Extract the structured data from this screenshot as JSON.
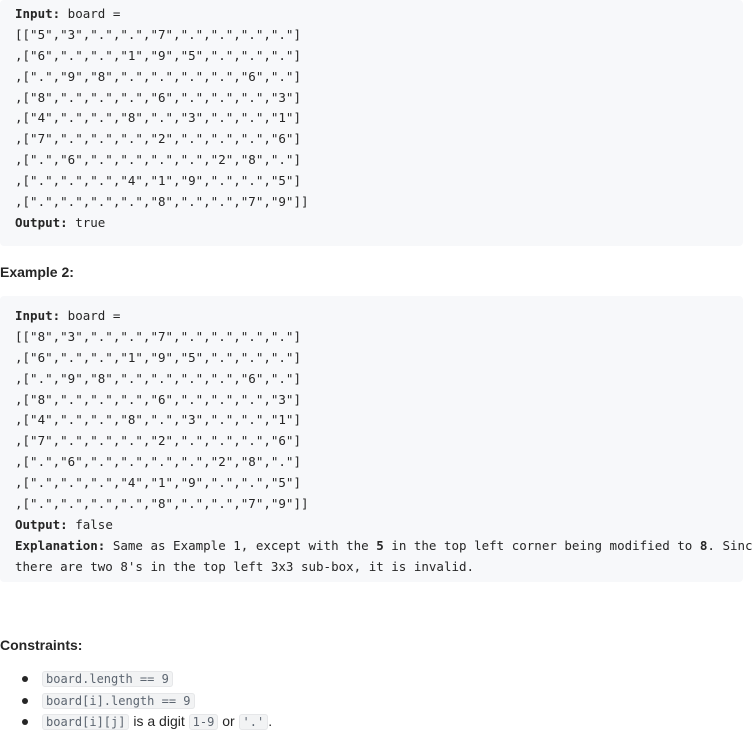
{
  "example1": {
    "input_label": "Input:",
    "input_var": " board =",
    "rows": [
      "[[\"5\",\"3\",\".\",\".\",\"7\",\".\",\".\",\".\",\".\"]",
      ",[\"6\",\".\",\".\",\"1\",\"9\",\"5\",\".\",\".\",\".\"]",
      ",[\".\",\"9\",\"8\",\".\",\".\",\".\",\".\",\"6\",\".\"]",
      ",[\"8\",\".\",\".\",\".\",\"6\",\".\",\".\",\".\",\"3\"]",
      ",[\"4\",\".\",\".\",\"8\",\".\",\"3\",\".\",\".\",\"1\"]",
      ",[\"7\",\".\",\".\",\".\",\"2\",\".\",\".\",\".\",\"6\"]",
      ",[\".\",\"6\",\".\",\".\",\".\",\".\",\"2\",\"8\",\".\"]",
      ",[\".\",\".\",\".\",\"4\",\"1\",\"9\",\".\",\".\",\"5\"]",
      ",[\".\",\".\",\".\",\".\",\"8\",\".\",\".\",\"7\",\"9\"]]"
    ],
    "output_label": "Output:",
    "output_value": " true"
  },
  "example2": {
    "heading": "Example 2:",
    "input_label": "Input:",
    "input_var": " board =",
    "rows": [
      "[[\"8\",\"3\",\".\",\".\",\"7\",\".\",\".\",\".\",\".\"]",
      ",[\"6\",\".\",\".\",\"1\",\"9\",\"5\",\".\",\".\",\".\"]",
      ",[\".\",\"9\",\"8\",\".\",\".\",\".\",\".\",\"6\",\".\"]",
      ",[\"8\",\".\",\".\",\".\",\"6\",\".\",\".\",\".\",\"3\"]",
      ",[\"4\",\".\",\".\",\"8\",\".\",\"3\",\".\",\".\",\"1\"]",
      ",[\"7\",\".\",\".\",\".\",\"2\",\".\",\".\",\".\",\"6\"]",
      ",[\".\",\"6\",\".\",\".\",\".\",\".\",\"2\",\"8\",\".\"]",
      ",[\".\",\".\",\".\",\"4\",\"1\",\"9\",\".\",\".\",\"5\"]",
      ",[\".\",\".\",\".\",\".\",\"8\",\".\",\".\",\"7\",\"9\"]]"
    ],
    "output_label": "Output:",
    "output_value": " false",
    "explanation_label": "Explanation:",
    "explanation_pre": " Same as Example 1, except with the ",
    "explanation_five": "5",
    "explanation_mid": " in the top left corner being modified to ",
    "explanation_eight": "8",
    "explanation_post": ". Since",
    "explanation_line2": "there are two 8's in the top left 3x3 sub-box, it is invalid."
  },
  "constraints": {
    "heading": "Constraints:",
    "items": [
      {
        "code": "board.length == 9"
      },
      {
        "code": "board[i].length == 9"
      },
      {
        "code": "board[i][j]",
        "text_mid": " is a digit ",
        "code2": "1-9",
        "text_or": " or ",
        "code3": "'.'",
        "text_end": "."
      }
    ]
  }
}
